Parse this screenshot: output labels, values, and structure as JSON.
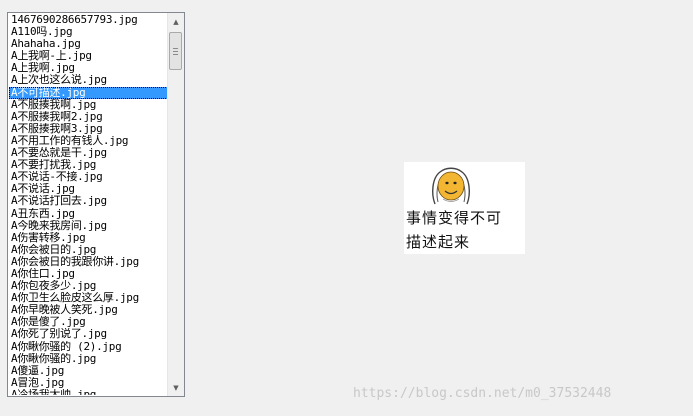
{
  "file_list": {
    "items": [
      "1467690286657793.jpg",
      "A110吗.jpg",
      "Ahahaha.jpg",
      "A上我啊-上.jpg",
      "A上我啊.jpg",
      "A上次也这么说.jpg",
      "A不可描述.jpg",
      "A不服揍我啊.jpg",
      "A不服揍我啊2.jpg",
      "A不服揍我啊3.jpg",
      "A不用工作的有钱人.jpg",
      "A不要怂就是干.jpg",
      "A不要打扰我.jpg",
      "A不说话-不接.jpg",
      "A不说话.jpg",
      "A不说话打回去.jpg",
      "A丑东西.jpg",
      "A今晚来我房间.jpg",
      "A伤害转移.jpg",
      "A你会被日的.jpg",
      "A你会被日的我跟你讲.jpg",
      "A你住口.jpg",
      "A你包夜多少.jpg",
      "A你卫生么脸皮这么厚.jpg",
      "A你早晚被人笑死.jpg",
      "A你是傻了.jpg",
      "A你死了别说了.jpg",
      "A你瞅你骚的 (2).jpg",
      "A你瞅你骚的.jpg",
      "A傻逼.jpg",
      "A冒泡.jpg",
      "A冷场我太帅.jpg"
    ],
    "selected_index": 6
  },
  "preview": {
    "caption_line1": "事情变得不可",
    "caption_line2": "描述起来",
    "face_color": "#f2b632"
  },
  "watermark": "https://blog.csdn.net/m0_37532448",
  "colors": {
    "selection": "#3399ff",
    "window_bg": "#f0f0f0"
  }
}
